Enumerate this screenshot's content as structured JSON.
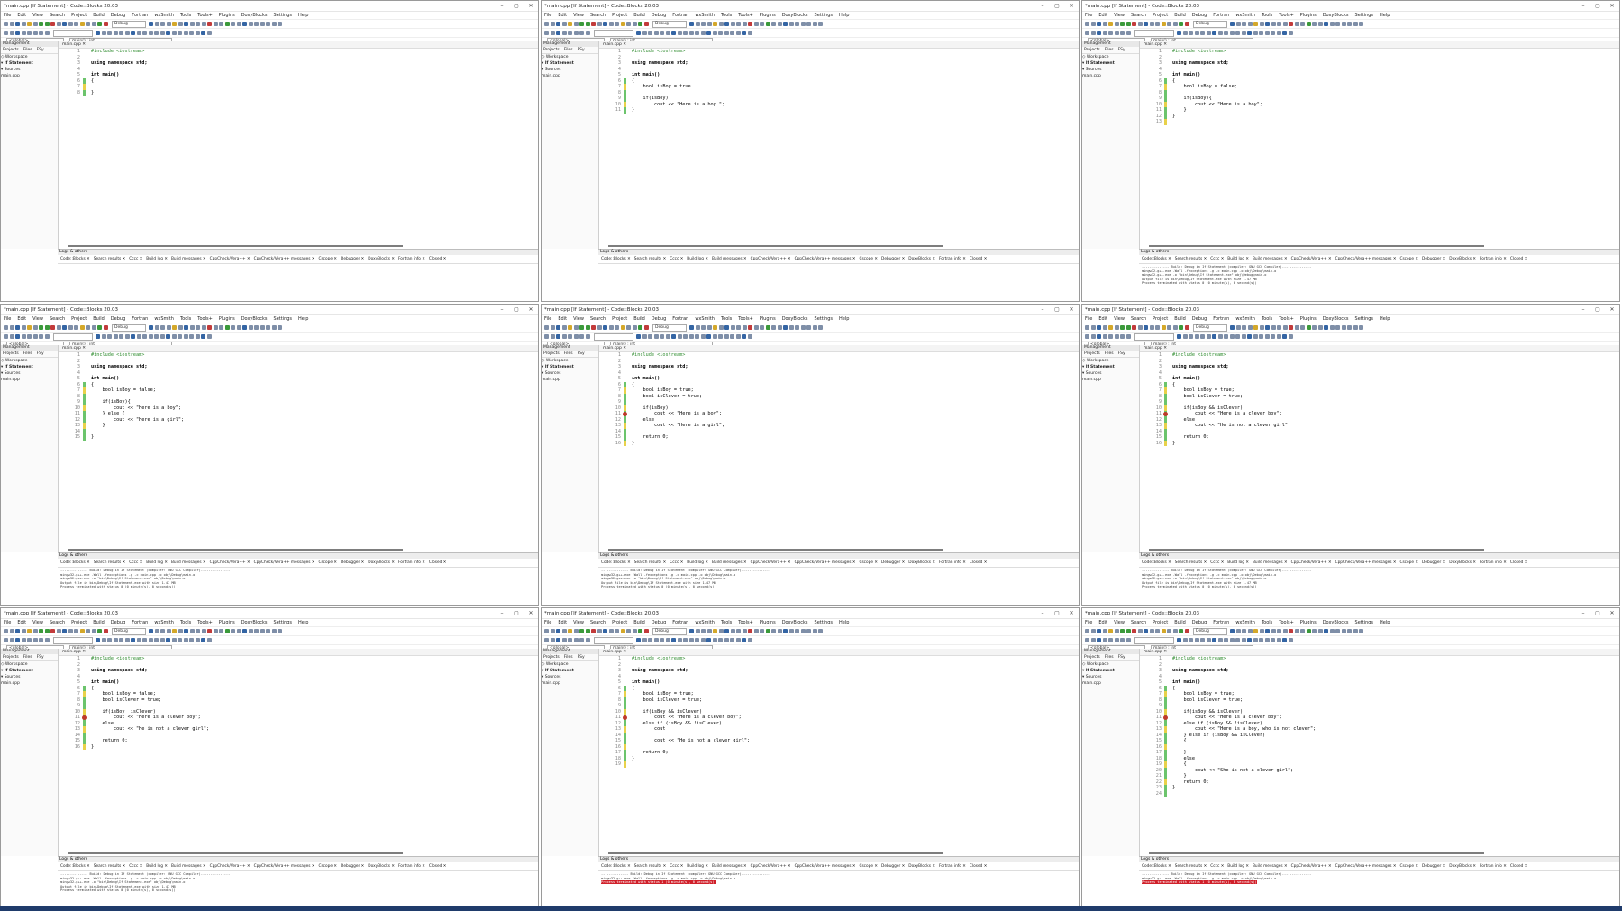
{
  "title": "*main.cpp [If Statement] - Code::Blocks 20.03",
  "menu": [
    "File",
    "Edit",
    "View",
    "Search",
    "Project",
    "Build",
    "Debug",
    "Fortran",
    "wxSmith",
    "Tools",
    "Tools+",
    "Plugins",
    "DoxyBlocks",
    "Settings",
    "Help"
  ],
  "build_target": "Debug",
  "scope": "<global>",
  "function_scope": "main() : int",
  "management": {
    "header": "Management",
    "tabs": [
      "Projects",
      "Files",
      "FSy"
    ],
    "workspace": "Workspace",
    "project": "If Statement",
    "sources_folder": "Sources",
    "file": "main.cpp"
  },
  "editor_tab": "main.cpp",
  "logs_header": "Logs & others",
  "log_tabs": [
    "Code::Blocks",
    "Search results",
    "Cccc",
    "Build log",
    "Build messages",
    "CppCheck/Vera++",
    "CppCheck/Vera++ messages",
    "Cscope",
    "Debugger",
    "DoxyBlocks",
    "Fortran info",
    "Closed"
  ],
  "build_ok_log": [
    "-------------- Build: Debug in If Statement (compiler: GNU GCC Compiler)---------------",
    "mingw32-g++.exe -Wall -fexceptions -g -c main.cpp -o obj\\Debug\\main.o",
    "mingw32-g++.exe -o \"bin\\Debug\\If Statement.exe\" obj\\Debug\\main.o",
    "Output file is bin\\Debug\\If Statement.exe with size 1.47 MB",
    "Process terminated with status 0 (0 minute(s), 0 second(s))"
  ],
  "build_err_log": [
    "-------------- Build: Debug in If Statement (compiler: GNU GCC Compiler)---------------",
    "mingw32-g++.exe -Wall -fexceptions -g -c main.cpp -o obj\\Debug\\main.o",
    "Process terminated with status 1 (0 minute(s), 0 second(s))"
  ],
  "err_line": "Process terminated with status 1 (0 minute(s), 0 second(s))",
  "windows": [
    {
      "lines": [
        "#include <iostream>",
        "",
        "using namespace std;",
        "",
        "int main()",
        "{",
        "",
        "}"
      ],
      "log": "",
      "err": false
    },
    {
      "lines": [
        "#include <iostream>",
        "",
        "using namespace std;",
        "",
        "int main()",
        "{",
        "    bool isBoy = true",
        "",
        "    if(isBoy)",
        "        cout << \"Here is a boy \";",
        "}"
      ],
      "log": "",
      "err": false
    },
    {
      "lines": [
        "#include <iostream>",
        "",
        "using namespace std;",
        "",
        "int main()",
        "{",
        "    bool isBoy = false;",
        "",
        "    if(isBoy){",
        "        cout << \"Here is a boy\";",
        "    }",
        "}",
        ""
      ],
      "log": "ok",
      "err": false
    },
    {
      "lines": [
        "#include <iostream>",
        "",
        "using namespace std;",
        "",
        "int main()",
        "{",
        "    bool isBoy = false;",
        "",
        "    if(isBoy){",
        "        cout << \"Here is a boy\";",
        "    } else {",
        "        cout << \"Here is a girl\";",
        "    }",
        "",
        "}"
      ],
      "log": "ok",
      "err": false
    },
    {
      "lines": [
        "#include <iostream>",
        "",
        "using namespace std;",
        "",
        "int main()",
        "{",
        "    bool isBoy = true;",
        "    bool isClever = true;",
        "",
        "    if(isBoy)",
        "        cout << \"Here is a boy\";",
        "    else",
        "        cout << \"Here is a girl\";",
        "",
        "    return 0;",
        "}"
      ],
      "log": "ok",
      "err": false
    },
    {
      "lines": [
        "#include <iostream>",
        "",
        "using namespace std;",
        "",
        "int main()",
        "{",
        "    bool isBoy = true;",
        "    bool isClever = true;",
        "",
        "    if(isBoy && isClever)",
        "        cout << \"Here is a clever boy\";",
        "    else",
        "        cout << \"He is not a clever girl\";",
        "",
        "    return 0;",
        "}"
      ],
      "log": "ok",
      "err": false
    },
    {
      "lines": [
        "#include <iostream>",
        "",
        "using namespace std;",
        "",
        "int main()",
        "{",
        "    bool isBoy = false;",
        "    bool isClever = true;",
        "",
        "    if(isBoy  isClever)",
        "        cout << \"Here is a clever boy\";",
        "    else",
        "        cout << \"He is not a clever girl\";",
        "",
        "    return 0;",
        "}"
      ],
      "log": "ok",
      "err": false
    },
    {
      "lines": [
        "#include <iostream>",
        "",
        "using namespace std;",
        "",
        "int main()",
        "{",
        "    bool isBoy = true;",
        "    bool isClever = true;",
        "",
        "    if(isBoy && isClever)",
        "        cout << \"Here is a clever boy\";",
        "    else if (isBoy && !isClever)",
        "        cout",
        "",
        "        cout << \"He is not a clever girl\";",
        "",
        "    return 0;",
        "}",
        ""
      ],
      "log": "err",
      "err": true
    },
    {
      "lines": [
        "#include <iostream>",
        "",
        "using namespace std;",
        "",
        "int main()",
        "{",
        "    bool isBoy = true;",
        "    bool isClever = true;",
        "",
        "    if(isBoy && isClever)",
        "        cout << \"Here is a clever boy\";",
        "    else if (isBoy && !isClever)",
        "        cout << \"Here is a boy, who is not clever\";",
        "    } else if (isBoy && isClever)",
        "    {",
        "",
        "    }",
        "    else",
        "    {",
        "        cout << \"She is not a clever girl\";",
        "    }",
        "    return 0;",
        "}",
        ""
      ],
      "log": "err",
      "err": true
    }
  ]
}
